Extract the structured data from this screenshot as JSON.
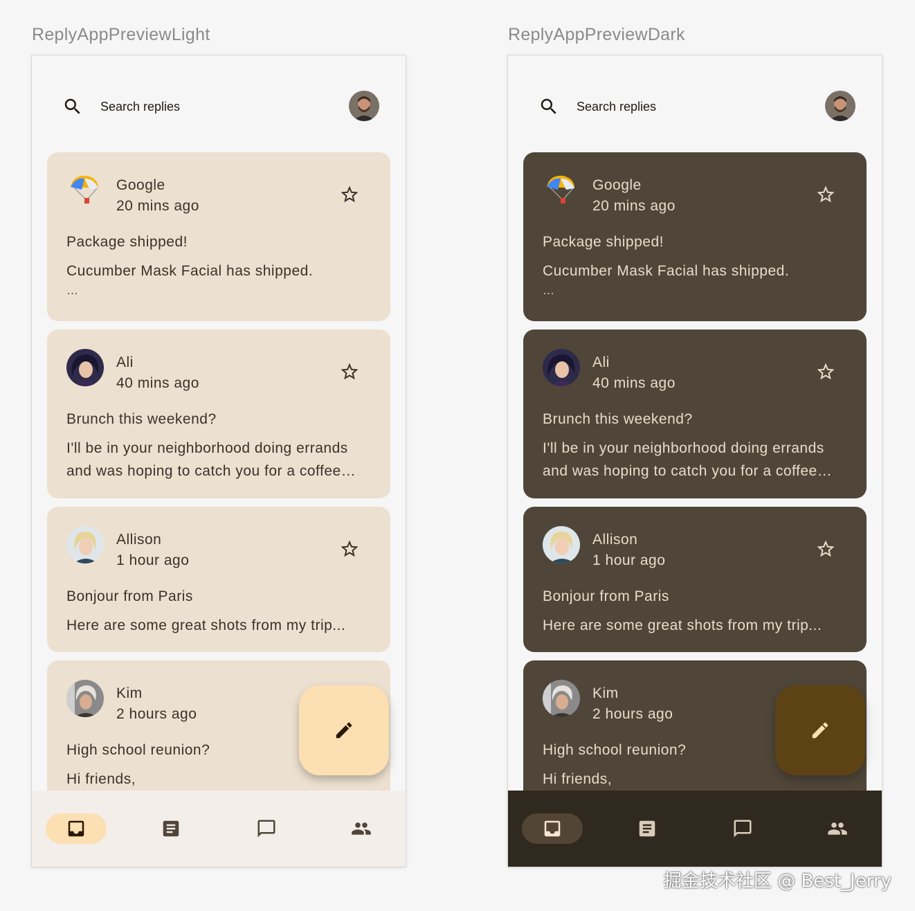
{
  "previews": [
    {
      "label": "ReplyAppPreviewLight",
      "search": {
        "text": "Search replies"
      },
      "emails": [
        {
          "sender": "Google",
          "time": "20 mins ago",
          "subject": "Package shipped!",
          "body": "Cucumber Mask Facial has shipped.",
          "extra": "…"
        },
        {
          "sender": "Ali",
          "time": "40 mins ago",
          "subject": "Brunch this weekend?",
          "body": "I'll be in your neighborhood doing errands and was hoping to catch you for a coffee…"
        },
        {
          "sender": "Allison",
          "time": "1 hour ago",
          "subject": "Bonjour from Paris",
          "body": "Here are some great shots from my trip..."
        },
        {
          "sender": "Kim",
          "time": "2 hours ago",
          "subject": "High school reunion?",
          "body": "Hi friends,"
        }
      ],
      "fab": {
        "icon": "edit-icon"
      },
      "nav": [
        {
          "icon": "inbox-icon",
          "active": true
        },
        {
          "icon": "article-icon",
          "active": false
        },
        {
          "icon": "chat-bubble-icon",
          "active": false
        },
        {
          "icon": "people-icon",
          "active": false
        }
      ],
      "colors": {
        "card": "#ece0d0",
        "fab": "#fcdfb2",
        "nav": "#f4eeea",
        "text": "#3a3128"
      }
    },
    {
      "label": "ReplyAppPreviewDark",
      "search": {
        "text": "Search replies"
      },
      "emails": [
        {
          "sender": "Google",
          "time": "20 mins ago",
          "subject": "Package shipped!",
          "body": "Cucumber Mask Facial has shipped.",
          "extra": "…"
        },
        {
          "sender": "Ali",
          "time": "40 mins ago",
          "subject": "Brunch this weekend?",
          "body": "I'll be in your neighborhood doing errands and was hoping to catch you for a coffee…"
        },
        {
          "sender": "Allison",
          "time": "1 hour ago",
          "subject": "Bonjour from Paris",
          "body": "Here are some great shots from my trip..."
        },
        {
          "sender": "Kim",
          "time": "2 hours ago",
          "subject": "High school reunion?",
          "body": "Hi friends,"
        }
      ],
      "fab": {
        "icon": "edit-icon"
      },
      "nav": [
        {
          "icon": "inbox-icon",
          "active": true
        },
        {
          "icon": "article-icon",
          "active": false
        },
        {
          "icon": "chat-bubble-icon",
          "active": false
        },
        {
          "icon": "people-icon",
          "active": false
        }
      ],
      "colors": {
        "card": "#4f4639",
        "fab": "#5c4215",
        "nav": "#30291f",
        "text": "#e8ddcc"
      }
    }
  ],
  "watermark": "掘金技术社区 @ Best_Jerry"
}
